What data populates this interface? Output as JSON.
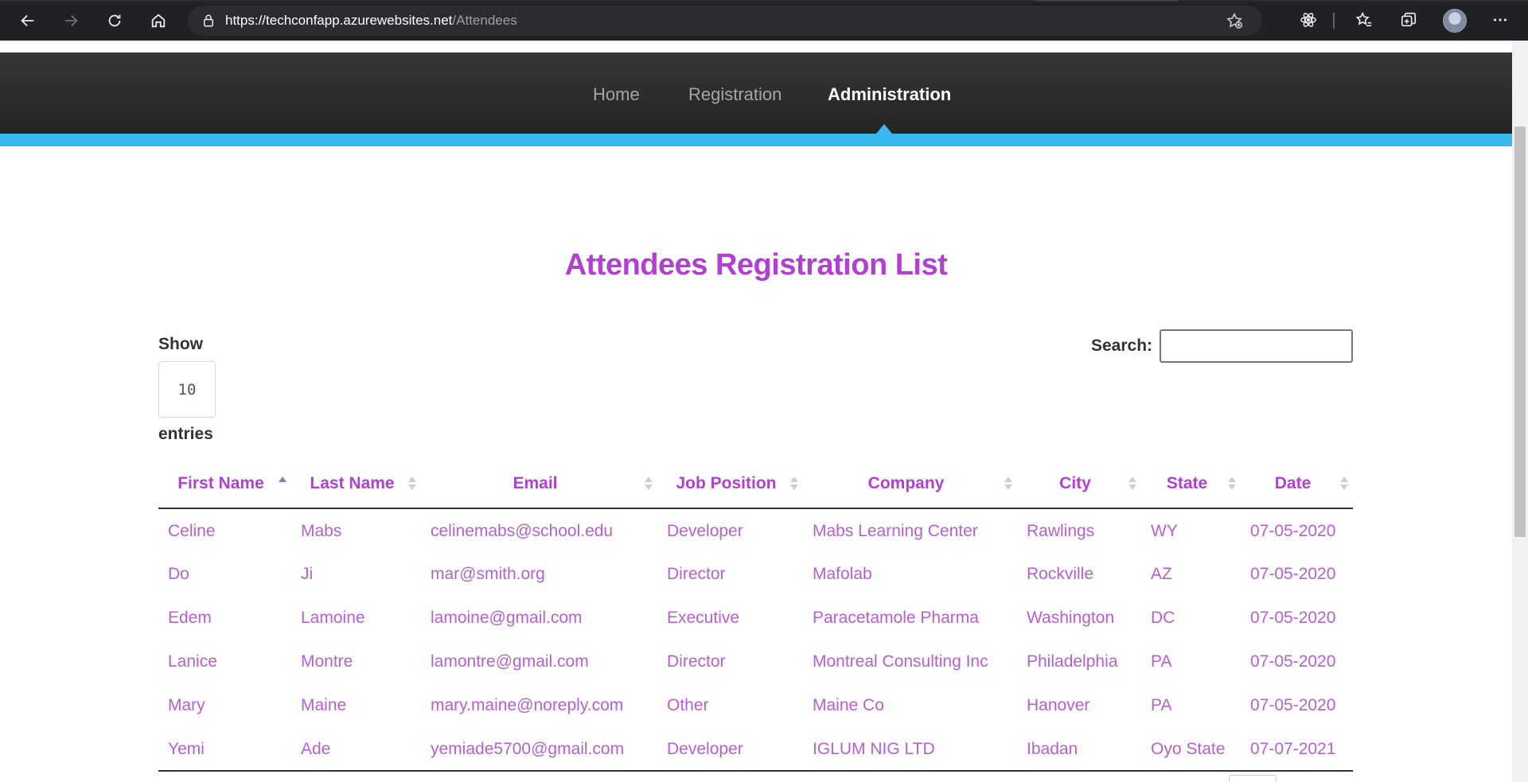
{
  "browser": {
    "url_host": "https://techconfapp.azurewebsites.net",
    "url_path": "/Attendees",
    "icons": [
      "back-icon",
      "forward-icon",
      "refresh-icon",
      "home-icon",
      "lock-icon",
      "add-favorite-icon",
      "extension-icon",
      "favorites-icon",
      "collections-icon",
      "profile-avatar",
      "more-icon"
    ]
  },
  "nav": {
    "items": [
      {
        "label": "Home"
      },
      {
        "label": "Registration"
      },
      {
        "label": "Administration",
        "active": true
      }
    ]
  },
  "page": {
    "title": "Attendees Registration List"
  },
  "controls": {
    "show_label": "Show",
    "page_length": "10",
    "entries_label": "entries",
    "search_label": "Search:",
    "search_value": ""
  },
  "table": {
    "columns": [
      {
        "label": "First Name",
        "sort": "asc"
      },
      {
        "label": "Last Name",
        "sort": "none"
      },
      {
        "label": "Email",
        "sort": "none"
      },
      {
        "label": "Job Position",
        "sort": "none"
      },
      {
        "label": "Company",
        "sort": "none"
      },
      {
        "label": "City",
        "sort": "none"
      },
      {
        "label": "State",
        "sort": "none"
      },
      {
        "label": "Date",
        "sort": "none"
      }
    ],
    "rows": [
      [
        "Celine",
        "Mabs",
        "celinemabs@school.edu",
        "Developer",
        "Mabs Learning Center",
        "Rawlings",
        "WY",
        "07-05-2020"
      ],
      [
        "Do",
        "Ji",
        "mar@smith.org",
        "Director",
        "Mafolab",
        "Rockville",
        "AZ",
        "07-05-2020"
      ],
      [
        "Edem",
        "Lamoine",
        "lamoine@gmail.com",
        "Executive",
        "Paracetamole Pharma",
        "Washington",
        "DC",
        "07-05-2020"
      ],
      [
        "Lanice",
        "Montre",
        "lamontre@gmail.com",
        "Director",
        "Montreal Consulting Inc",
        "Philadelphia",
        "PA",
        "07-05-2020"
      ],
      [
        "Mary",
        "Maine",
        "mary.maine@noreply.com",
        "Other",
        "Maine Co",
        "Hanover",
        "PA",
        "07-05-2020"
      ],
      [
        "Yemi",
        "Ade",
        "yemiade5700@gmail.com",
        "Developer",
        "IGLUM NIG LTD",
        "Ibadan",
        "Oyo State",
        "07-07-2021"
      ]
    ]
  },
  "colors": {
    "accent": "#39b8ef",
    "heading": "#b13fd2",
    "cell_text": "#b760d0",
    "nav_bg": "#2b2b2b"
  }
}
